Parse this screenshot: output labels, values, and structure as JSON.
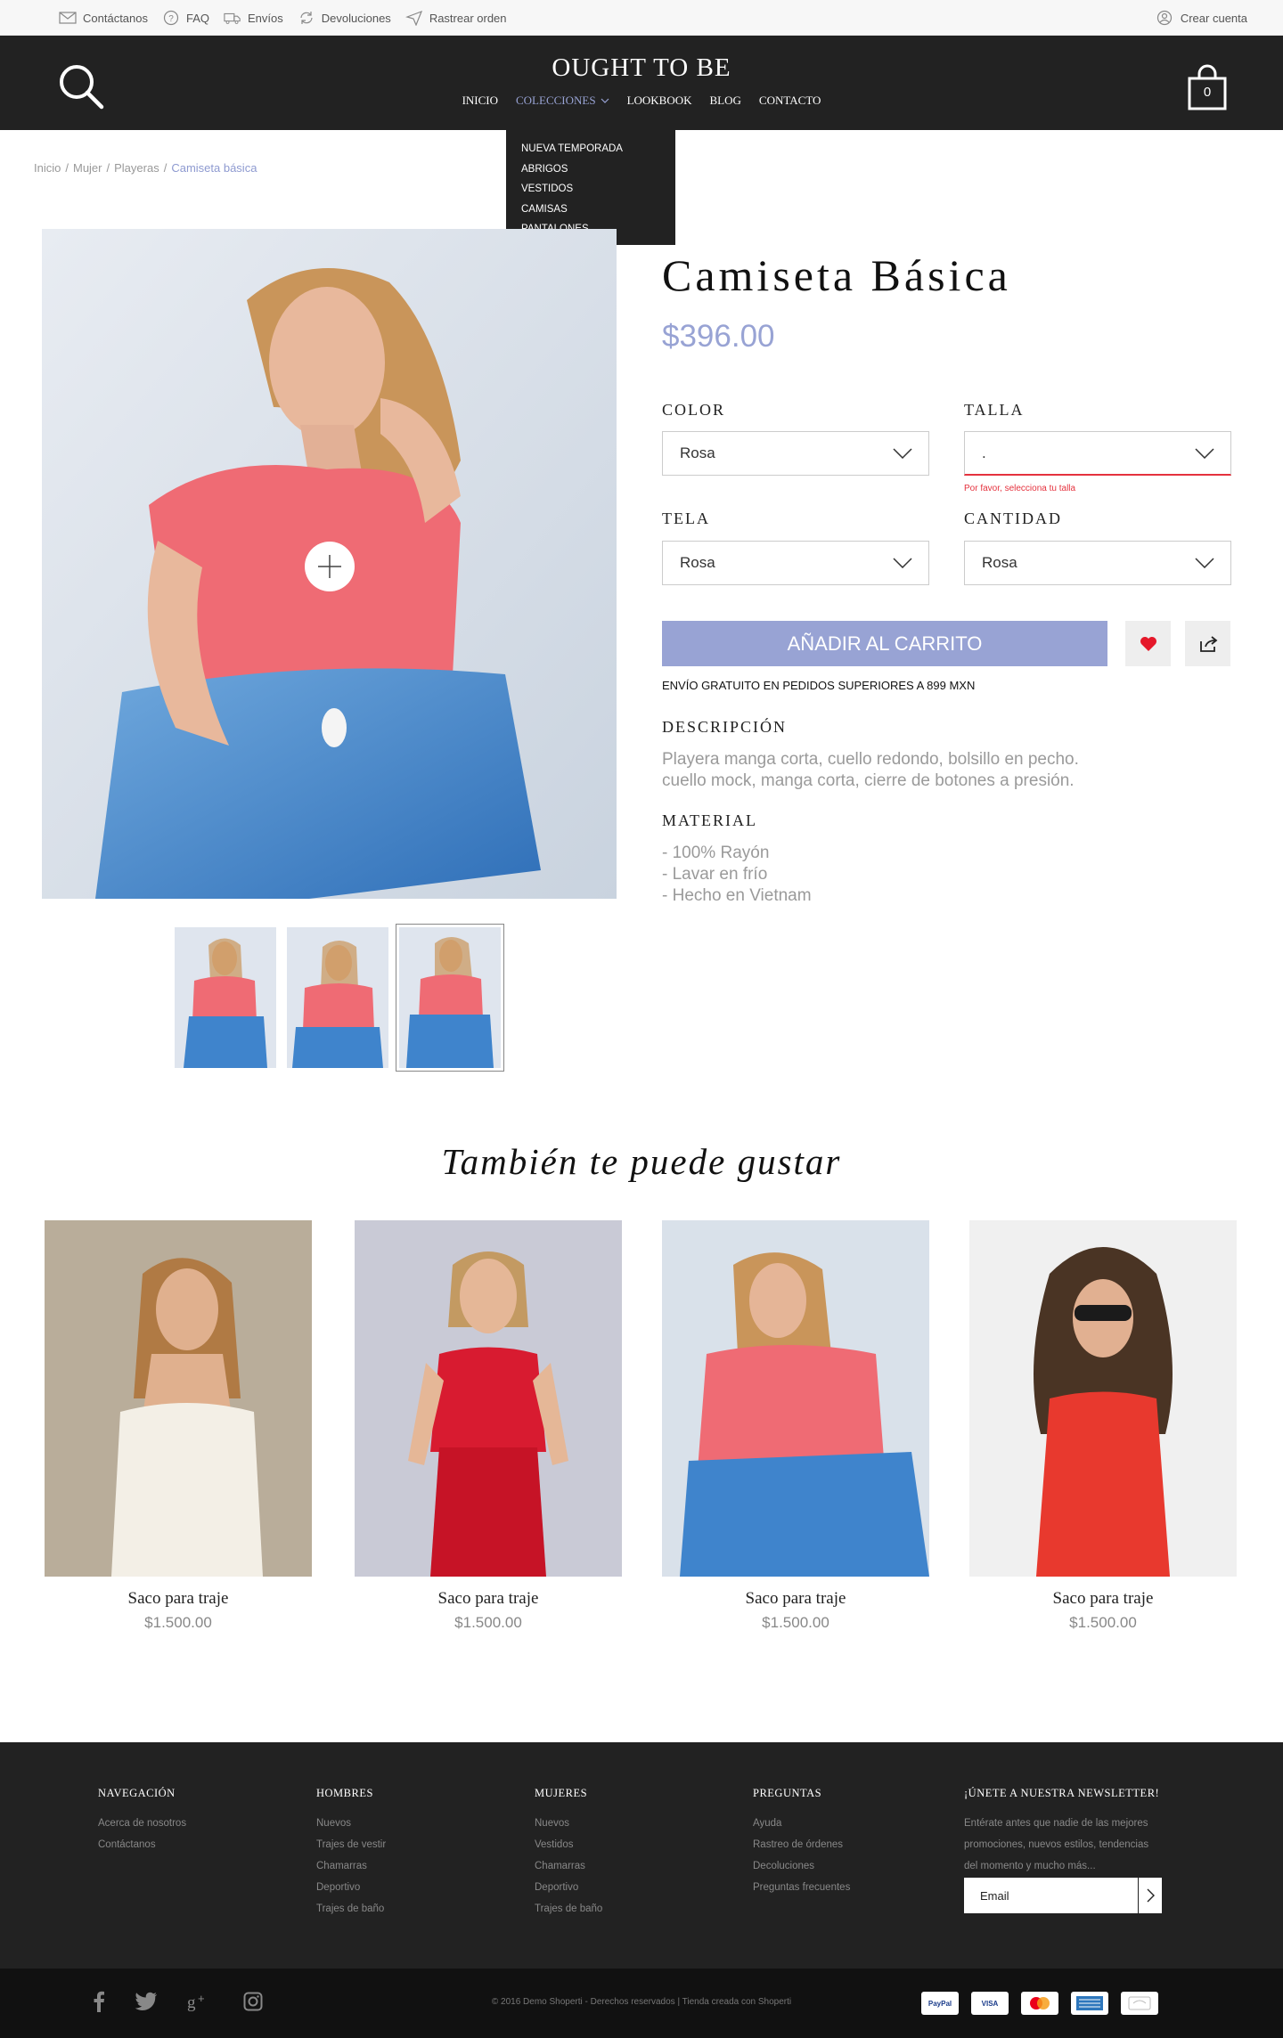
{
  "topbar": {
    "links": [
      {
        "label": "Contáctanos",
        "icon": "mail-icon"
      },
      {
        "label": "FAQ",
        "icon": "help-icon"
      },
      {
        "label": "Envíos",
        "icon": "truck-icon"
      },
      {
        "label": "Devoluciones",
        "icon": "refresh-icon"
      },
      {
        "label": "Rastrear orden",
        "icon": "send-icon"
      }
    ],
    "account_label": "Crear cuenta"
  },
  "header": {
    "brand": "OUGHT TO BE",
    "nav": [
      "INICIO",
      "COLECCIONES",
      "LOOKBOOK",
      "BLOG",
      "CONTACTO"
    ],
    "active_nav": "COLECCIONES",
    "cart_count": "0"
  },
  "dropdown": [
    "NUEVA TEMPORADA",
    "ABRIGOS",
    "VESTIDOS",
    "CAMISAS",
    "PANTALONES"
  ],
  "breadcrumb": [
    "Inicio",
    "Mujer",
    "Playeras",
    "Camiseta básica"
  ],
  "product": {
    "title": "Camiseta Básica",
    "price": "$396.00",
    "color_label": "COLOR",
    "color_value": "Rosa",
    "size_label": "TALLA",
    "size_value": ".",
    "size_error": "Por favor, selecciona tu talla",
    "fabric_label": "TELA",
    "fabric_value": "Rosa",
    "quantity_label": "CANTIDAD",
    "quantity_value": "Rosa",
    "add_to_cart": "AÑADIR AL CARRITO",
    "shipping_note": "ENVÍO GRATUITO EN PEDIDOS SUPERIORES A 899 MXN",
    "description_label": "DESCRIPCIÓN",
    "description_lines": [
      "Playera manga corta, cuello redondo, bolsillo en pecho.",
      "cuello mock, manga corta, cierre de botones a presión."
    ],
    "material_label": "MATERIAL",
    "material_lines": [
      "- 100% Rayón",
      "- Lavar en frío",
      "- Hecho en Vietnam"
    ]
  },
  "recommendations": {
    "title": "También te puede gustar",
    "items": [
      {
        "name": "Saco para traje",
        "price": "$1.500.00"
      },
      {
        "name": "Saco para traje",
        "price": "$1.500.00"
      },
      {
        "name": "Saco para traje",
        "price": "$1.500.00"
      },
      {
        "name": "Saco para traje",
        "price": "$1.500.00"
      }
    ]
  },
  "footer": {
    "columns": [
      {
        "heading": "NAVEGACIÓN",
        "links": [
          "Acerca de nosotros",
          "Contáctanos"
        ]
      },
      {
        "heading": "HOMBRES",
        "links": [
          "Nuevos",
          "Trajes de vestir",
          "Chamarras",
          "Deportivo",
          "Trajes de baño"
        ]
      },
      {
        "heading": "MUJERES",
        "links": [
          "Nuevos",
          "Vestidos",
          "Chamarras",
          "Deportivo",
          "Trajes de baño"
        ]
      },
      {
        "heading": "PREGUNTAS",
        "links": [
          "Ayuda",
          "Rastreo de órdenes",
          "Decoluciones",
          "Preguntas frecuentes"
        ]
      }
    ],
    "newsletter_heading": "¡ÚNETE A NUESTRA NEWSLETTER!",
    "newsletter_lines": [
      "Entérate antes que nadie de las mejores",
      "promociones, nuevos estilos, tendencias",
      "del momento y mucho más..."
    ],
    "email_placeholder": "Email",
    "copyright": "© 2016 Demo Shoperti - Derechos reservados | Tienda creada con Shoperti",
    "payments": [
      "PayPal",
      "VISA",
      "",
      "",
      ""
    ]
  },
  "colors": {
    "accent": "#98a3d4",
    "dark": "#222222",
    "error": "#e5323e"
  }
}
